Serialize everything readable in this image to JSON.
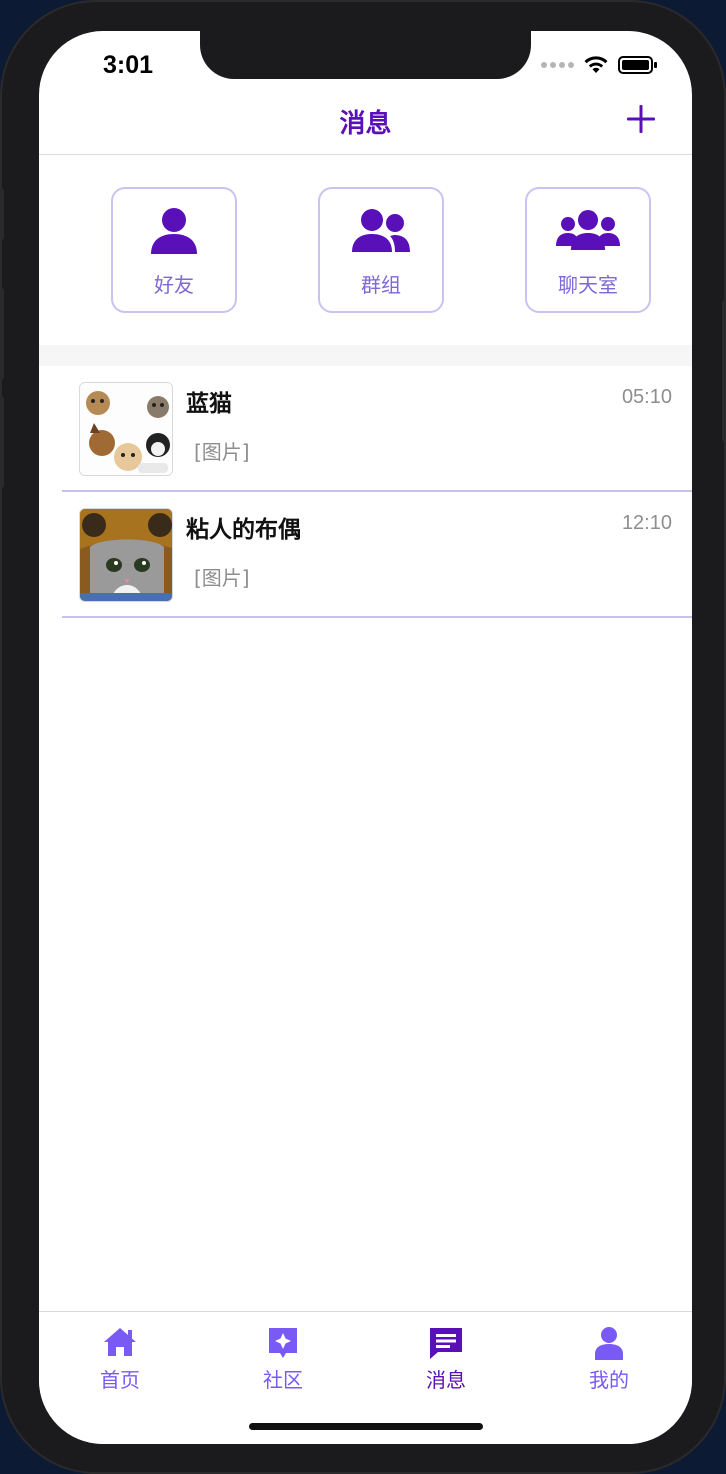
{
  "status": {
    "time": "3:01"
  },
  "header": {
    "title": "消息",
    "add_icon": "plus-icon"
  },
  "quick_entries": [
    {
      "label": "好友",
      "icon": "user-icon"
    },
    {
      "label": "群组",
      "icon": "users-icon"
    },
    {
      "label": "聊天室",
      "icon": "user-group-icon"
    }
  ],
  "conversations": [
    {
      "name": "蓝猫",
      "time": "05:10",
      "preview": "[图片]",
      "avatar": "dogs-cats-avatar"
    },
    {
      "name": "粘人的布偶",
      "time": "12:10",
      "preview": "[图片]",
      "avatar": "kitten-hat-avatar"
    }
  ],
  "tabbar": {
    "items": [
      {
        "label": "首页",
        "icon": "home-icon"
      },
      {
        "label": "社区",
        "icon": "community-icon"
      },
      {
        "label": "消息",
        "icon": "message-icon",
        "active": true
      },
      {
        "label": "我的",
        "icon": "profile-icon"
      }
    ]
  },
  "colors": {
    "primary": "#5a10b8",
    "accent": "#7a5af5",
    "border": "#c9c3f1"
  }
}
